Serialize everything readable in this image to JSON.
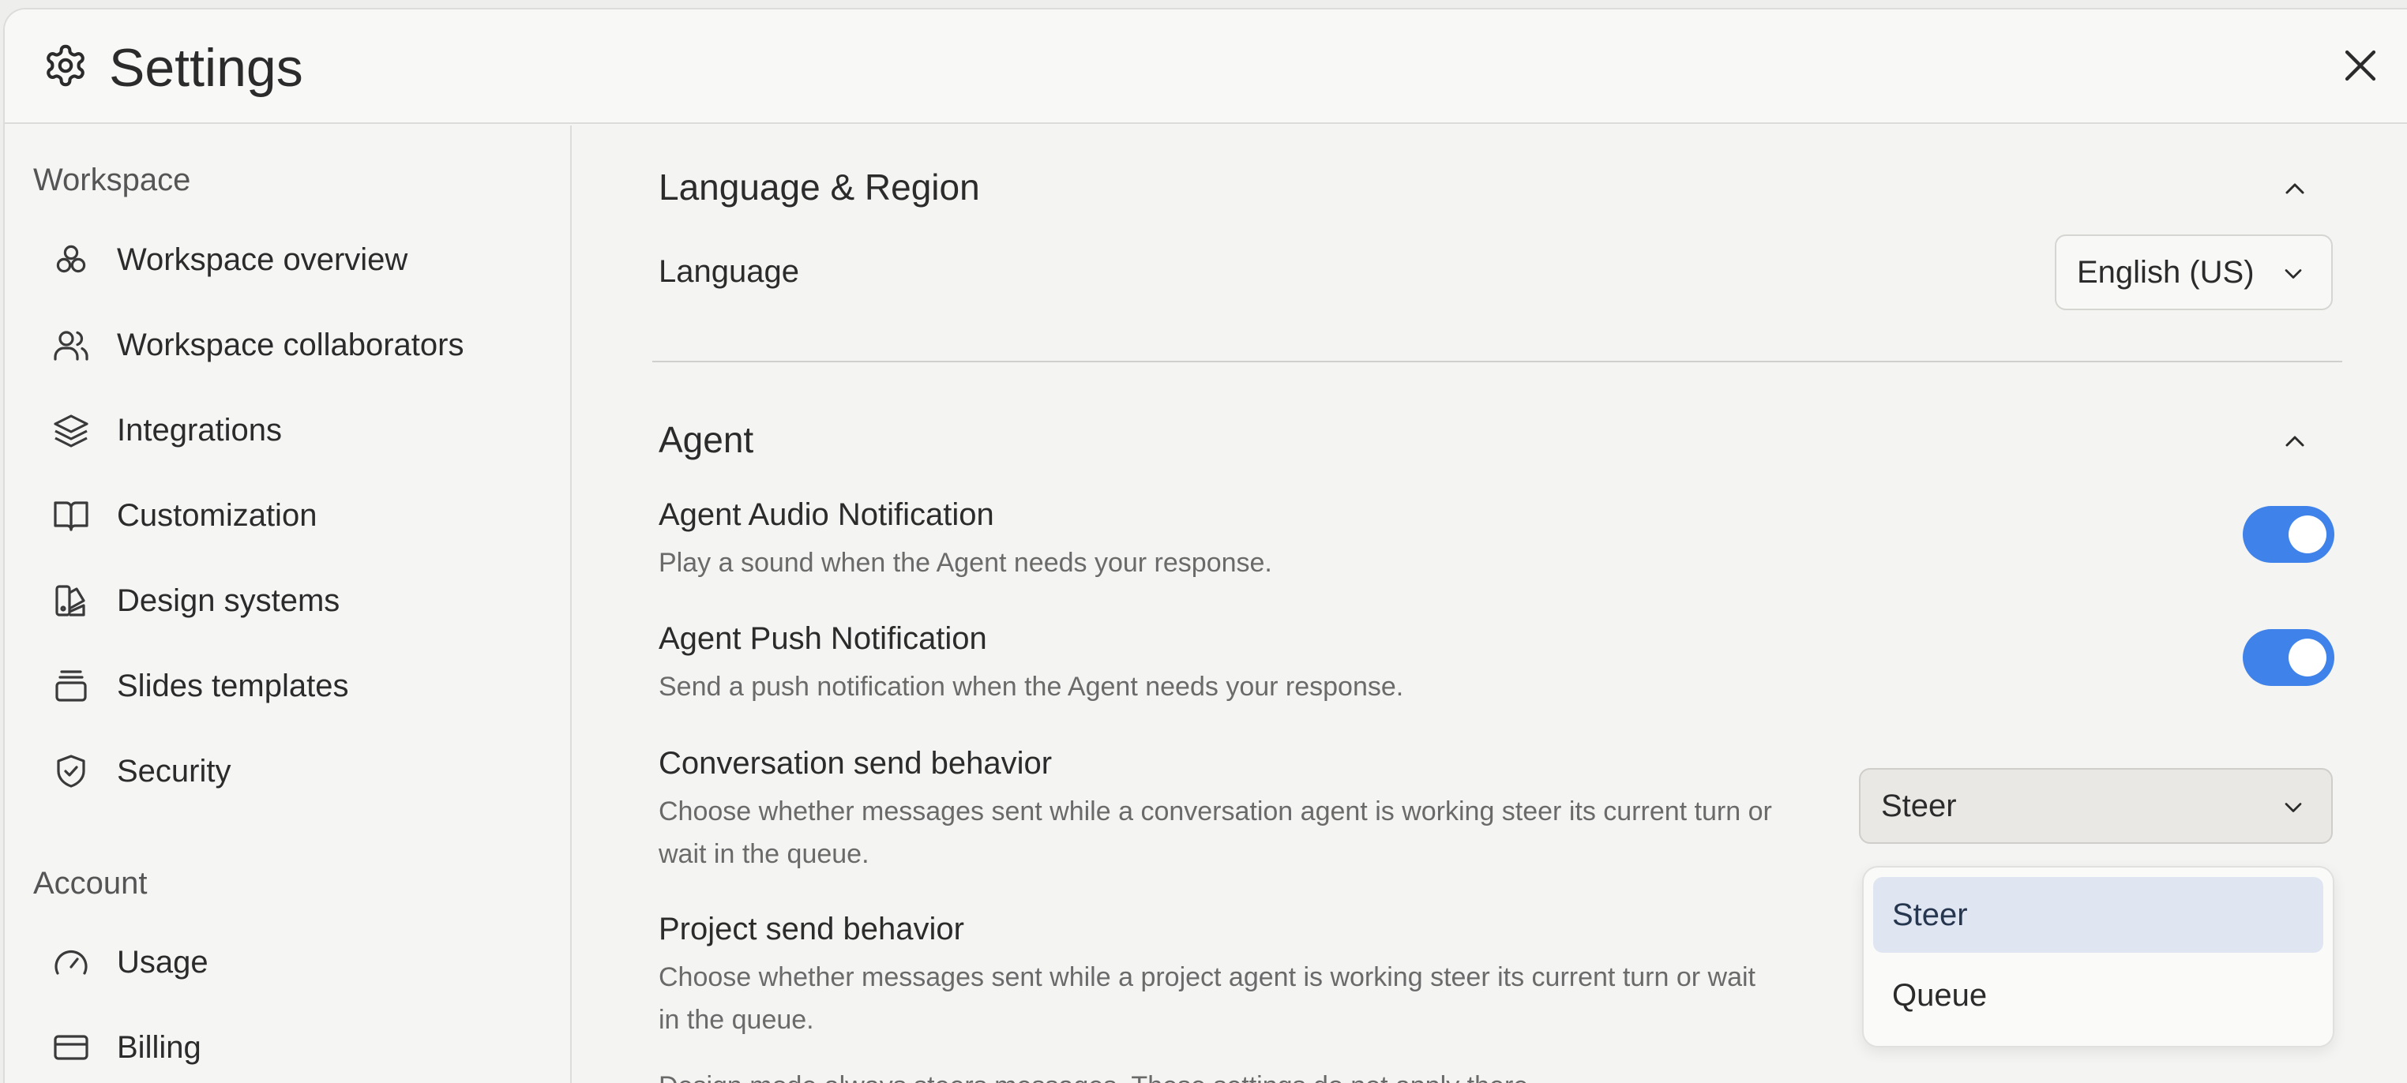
{
  "header": {
    "title": "Settings",
    "icon": "gear-icon",
    "close_icon": "close-icon"
  },
  "sidebar": {
    "groups": [
      {
        "title": "Workspace",
        "items": [
          {
            "label": "Workspace overview",
            "icon": "circles-icon"
          },
          {
            "label": "Workspace collaborators",
            "icon": "users-icon"
          },
          {
            "label": "Integrations",
            "icon": "layers-icon"
          },
          {
            "label": "Customization",
            "icon": "book-icon"
          },
          {
            "label": "Design systems",
            "icon": "palette-icon"
          },
          {
            "label": "Slides templates",
            "icon": "slides-stack-icon"
          },
          {
            "label": "Security",
            "icon": "shield-check-icon"
          }
        ]
      },
      {
        "title": "Account",
        "items": [
          {
            "label": "Usage",
            "icon": "gauge-icon"
          },
          {
            "label": "Billing",
            "icon": "credit-card-icon"
          }
        ]
      }
    ]
  },
  "main": {
    "language_region": {
      "title": "Language & Region",
      "language_label": "Language",
      "language_value": "English (US)"
    },
    "agent": {
      "title": "Agent",
      "audio": {
        "label": "Agent Audio Notification",
        "desc": "Play a sound when the Agent needs your response.",
        "enabled": true
      },
      "push": {
        "label": "Agent Push Notification",
        "desc": "Send a push notification when the Agent needs your response.",
        "enabled": true
      },
      "conversation": {
        "label": "Conversation send behavior",
        "desc_line1": "Choose whether messages sent while a conversation agent is working steer its current turn or",
        "desc_line2": "wait in the queue.",
        "value": "Steer"
      },
      "project": {
        "label": "Project send behavior",
        "desc_line1": "Choose whether messages sent while a project agent is working steer its current turn or wait",
        "desc_line2": "in the queue."
      },
      "note": "Design mode always steers messages. These settings do not apply there.",
      "dropdown_options": [
        "Steer",
        "Queue"
      ],
      "dropdown_selected": "Steer"
    }
  },
  "colors": {
    "accent": "#3f82ea",
    "selected_option_bg": "#e0e6f1"
  }
}
